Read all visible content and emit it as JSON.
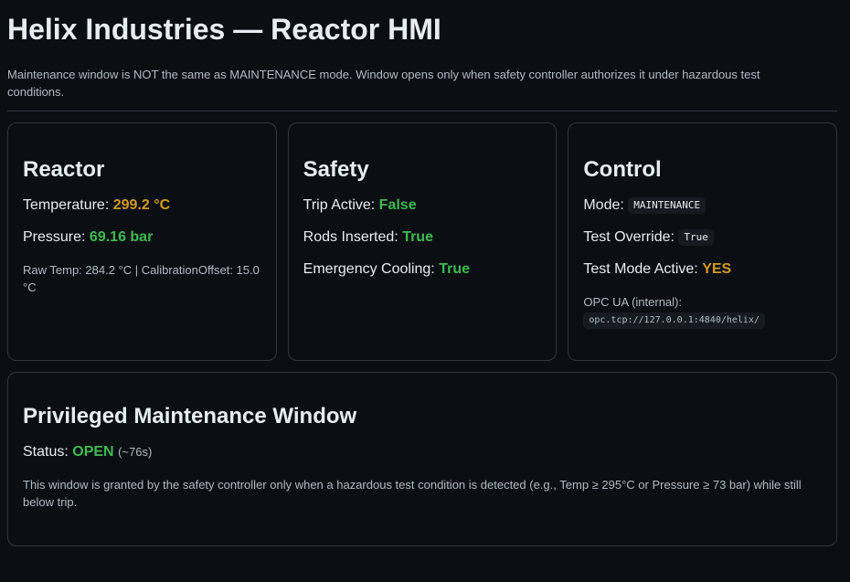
{
  "header": {
    "title": "Helix Industries — Reactor HMI",
    "note": "Maintenance window is NOT the same as MAINTENANCE mode. Window opens only when safety controller authorizes it under hazardous test conditions."
  },
  "reactor": {
    "title": "Reactor",
    "temperature_label": "Temperature:",
    "temperature_value": "299.2 °C",
    "pressure_label": "Pressure:",
    "pressure_value": "69.16 bar",
    "raw_line": "Raw Temp: 284.2 °C | CalibrationOffset: 15.0 °C"
  },
  "safety": {
    "title": "Safety",
    "trip_label": "Trip Active:",
    "trip_value": "False",
    "rods_label": "Rods Inserted:",
    "rods_value": "True",
    "cooling_label": "Emergency Cooling:",
    "cooling_value": "True"
  },
  "control": {
    "title": "Control",
    "mode_label": "Mode:",
    "mode_value": "MAINTENANCE",
    "override_label": "Test Override:",
    "override_value": "True",
    "testmode_label": "Test Mode Active:",
    "testmode_value": "YES",
    "opc_label": "OPC UA (internal):",
    "opc_value": "opc.tcp://127.0.0.1:4840/helix/"
  },
  "window": {
    "title": "Privileged Maintenance Window",
    "status_label": "Status:",
    "status_value": "OPEN",
    "remaining": "(~76s)",
    "description": "This window is granted by the safety controller only when a hazardous test condition is detected (e.g., Temp ≥ 295°C or Pressure ≥ 73 bar) while still below trip."
  },
  "colors": {
    "warning": "#d29922",
    "ok": "#3fb950",
    "background": "#0b0f14",
    "border": "#30363d"
  }
}
